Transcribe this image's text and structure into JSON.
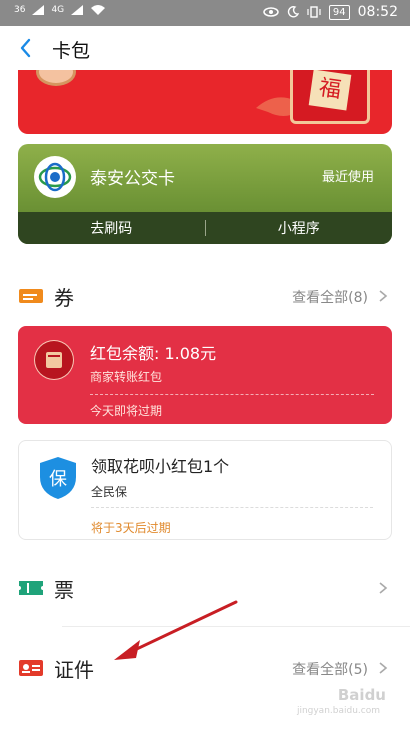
{
  "status_bar": {
    "signal_1": "36",
    "signal_2": "4G",
    "battery": "94",
    "time": "08:52"
  },
  "header": {
    "title": "卡包"
  },
  "banner": {
    "fu_text": "福"
  },
  "bus_card": {
    "name": "泰安公交卡",
    "recent": "最近使用",
    "actions": [
      "去刷码",
      "小程序"
    ]
  },
  "sections": {
    "coupons": {
      "label": "券",
      "more": "查看全部(8)"
    },
    "tickets": {
      "label": "票"
    },
    "ids": {
      "label": "证件",
      "more": "查看全部(5)"
    }
  },
  "coupons": [
    {
      "title": "红包余额: 1.08元",
      "subtitle": "商家转账红包",
      "expire": "今天即将过期"
    },
    {
      "title": "领取花呗小红包1个",
      "subtitle": "全民保",
      "expire": "将于3天后过期",
      "icon_text": "保"
    }
  ],
  "watermark": {
    "brand": "Baidu",
    "url": "jingyan.baidu.com"
  },
  "colors": {
    "accent_blue": "#1a8ae6",
    "coupon_red": "#e33045",
    "bus_green": "#6e9436",
    "expire_orange": "#e08a2e",
    "arrow_red": "#c81e24"
  },
  "icons": [
    "back-icon",
    "wifi-icon",
    "eye-icon",
    "moon-icon",
    "vibrate-icon",
    "coupon-icon",
    "ticket-icon",
    "id-card-icon",
    "chevron-right-icon",
    "red-packet-icon",
    "bao-shield-icon",
    "bus-logo-icon"
  ]
}
